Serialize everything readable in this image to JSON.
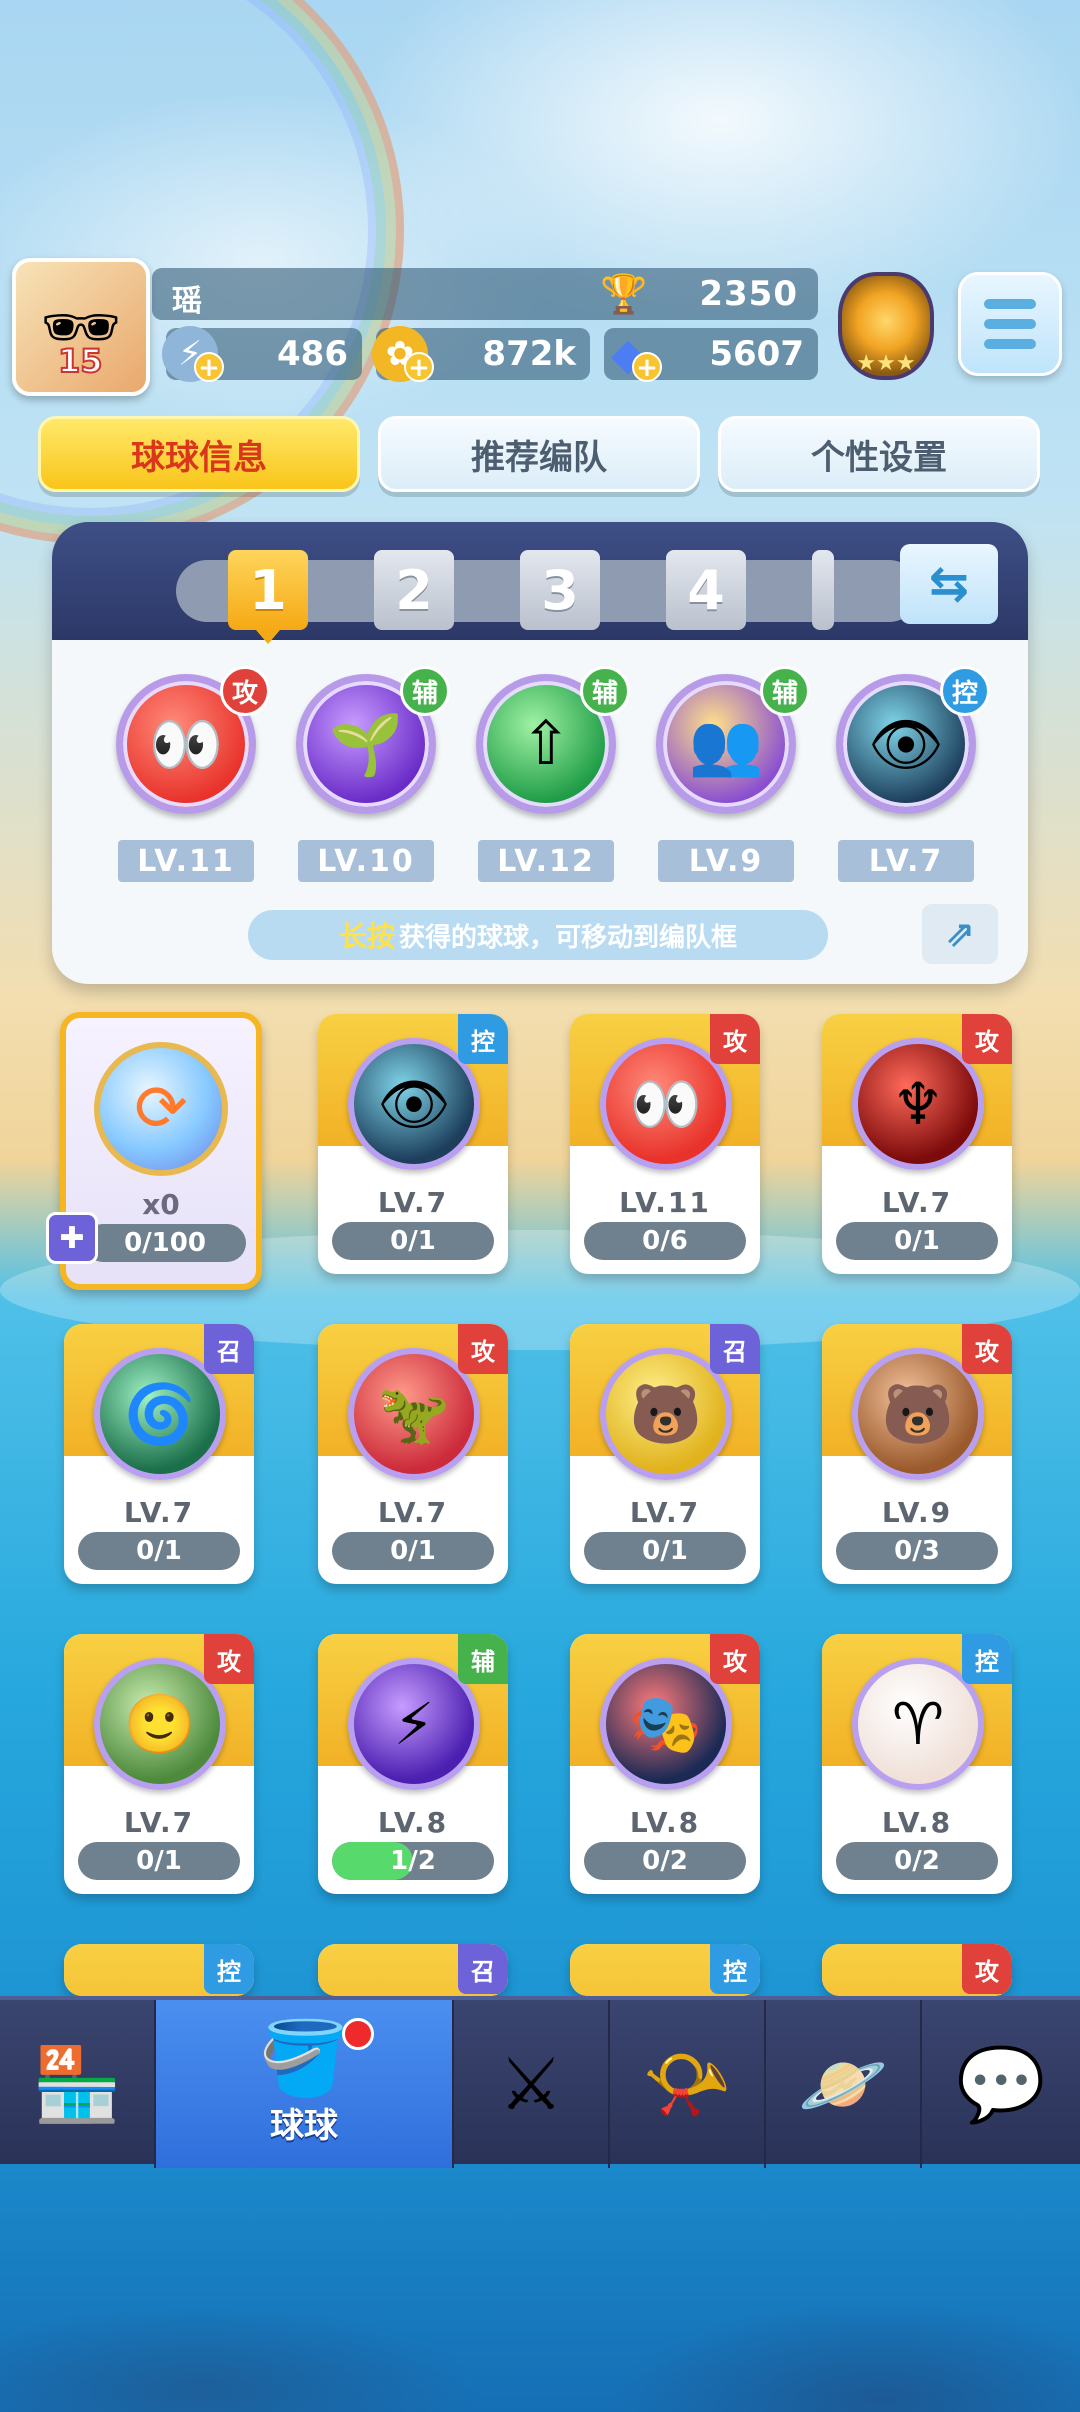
{
  "header": {
    "player_name": "瑶",
    "avatar_level": "15",
    "trophies": "2350",
    "resources": [
      {
        "icon": "energy-icon",
        "value": "486"
      },
      {
        "icon": "gold-coin-icon",
        "value": "872k"
      },
      {
        "icon": "gem-icon",
        "value": "5607"
      }
    ]
  },
  "tabs": [
    "球球信息",
    "推荐编队",
    "个性设置"
  ],
  "team": {
    "slots": [
      "1",
      "2",
      "3",
      "4"
    ],
    "active_slot": "1",
    "members": [
      {
        "icon": "red-blob-icon",
        "tag": "攻",
        "level": "LV.11"
      },
      {
        "icon": "purple-sprout-icon",
        "tag": "辅",
        "level": "LV.10"
      },
      {
        "icon": "green-arrow-icon",
        "tag": "辅",
        "level": "LV.12"
      },
      {
        "icon": "golden-crowd-icon",
        "tag": "辅",
        "level": "LV.9"
      },
      {
        "icon": "dark-ghost-icon",
        "tag": "控",
        "level": "LV.7"
      }
    ],
    "hint_key": "长按",
    "hint_text": "获得的球球，可移动到编队框"
  },
  "collection": {
    "special": {
      "count": "x0",
      "progress": "0/100"
    },
    "cards": [
      {
        "icon": "dark-ghost-icon",
        "tag": "控",
        "level": "LV.7",
        "progress": "0/1",
        "fill": 0
      },
      {
        "icon": "red-blob-icon",
        "tag": "攻",
        "level": "LV.11",
        "progress": "0/6",
        "fill": 0
      },
      {
        "icon": "trident-icon",
        "tag": "攻",
        "level": "LV.7",
        "progress": "0/1",
        "fill": 0
      },
      {
        "icon": "green-swirl-icon",
        "tag": "召",
        "level": "LV.7",
        "progress": "0/1",
        "fill": 0
      },
      {
        "icon": "red-dinosaur-icon",
        "tag": "攻",
        "level": "LV.7",
        "progress": "0/1",
        "fill": 0
      },
      {
        "icon": "yellow-bear-icon",
        "tag": "召",
        "level": "LV.7",
        "progress": "0/1",
        "fill": 0
      },
      {
        "icon": "brown-bear-icon",
        "tag": "攻",
        "level": "LV.9",
        "progress": "0/3",
        "fill": 0
      },
      {
        "icon": "ranger-face-icon",
        "tag": "攻",
        "level": "LV.7",
        "progress": "0/1",
        "fill": 0
      },
      {
        "icon": "lightning-icon",
        "tag": "辅",
        "level": "LV.8",
        "progress": "1/2",
        "fill": 0.5
      },
      {
        "icon": "opera-mask-icon",
        "tag": "攻",
        "level": "LV.8",
        "progress": "0/2",
        "fill": 0
      },
      {
        "icon": "ram-horn-icon",
        "tag": "控",
        "level": "LV.8",
        "progress": "0/2",
        "fill": 0
      }
    ],
    "partial_tags": [
      "控",
      "召",
      "控",
      "攻"
    ]
  },
  "nav": {
    "items": [
      {
        "icon": "shop-icon",
        "label": ""
      },
      {
        "icon": "ball-bucket-icon",
        "label": "球球"
      },
      {
        "icon": "crossed-swords-icon",
        "label": ""
      },
      {
        "icon": "whistle-icon",
        "label": ""
      },
      {
        "icon": "planet-icon",
        "label": ""
      },
      {
        "icon": "chat-heart-icon",
        "label": ""
      }
    ],
    "active": 1
  },
  "colors": {
    "attack": "#e0413a",
    "support": "#46b24c",
    "control": "#2e9be3",
    "summon": "#6d62d8",
    "accent": "#f9c51a"
  }
}
